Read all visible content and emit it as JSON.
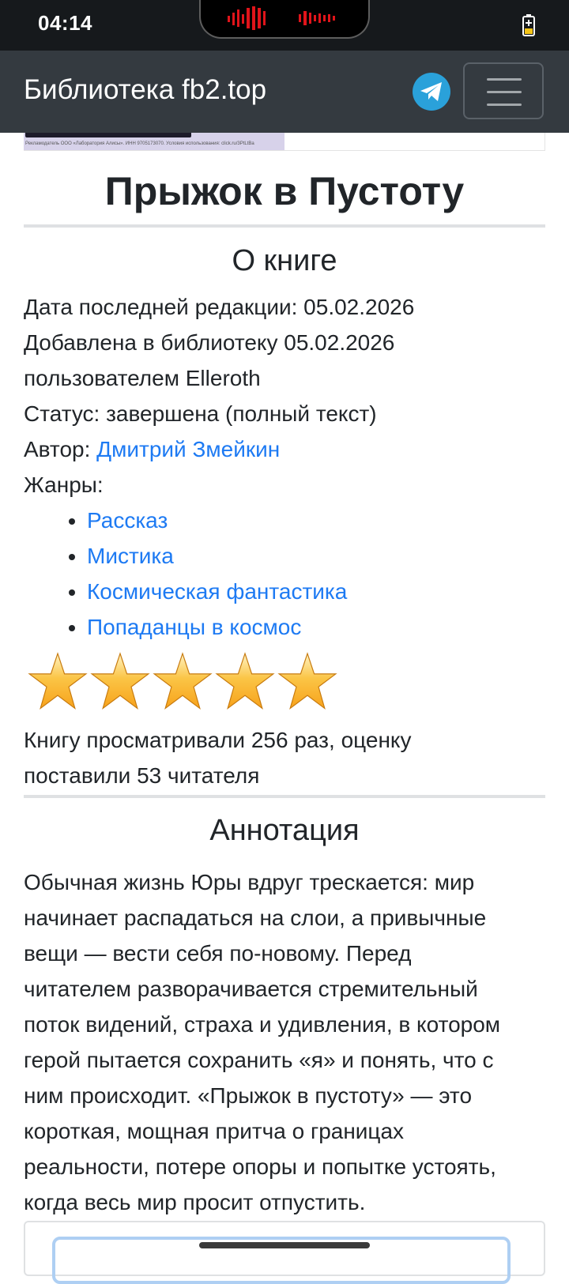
{
  "status_bar": {
    "time": "04:14"
  },
  "navbar": {
    "brand": "Библиотека fb2.top"
  },
  "book": {
    "title": "Прыжок в Пустоту",
    "about_heading": "О книге",
    "last_edit": "Дата последней редакции: 05.02.2026",
    "added_line1": "Добавлена в библиотеку 05.02.2026",
    "added_line2": "пользователем Elleroth",
    "status": "Статус: завершена (полный текст)",
    "author_label": "Автор: ",
    "author_name": "Дмитрий Змейкин",
    "genres_label": "Жанры:",
    "genres": [
      "Рассказ",
      "Мистика",
      "Космическая фантастика",
      "Попаданцы в космос"
    ],
    "rating": {
      "stars_filled": 5,
      "stars_total": 5
    },
    "views_line1": "Книгу просматривали 256 раз, оценку",
    "views_line2": "поставили 53 читателя"
  },
  "annotation": {
    "heading": "Аннотация",
    "lines": [
      "Обычная жизнь Юры вдруг трескается: мир",
      "начинает распадаться на слои, а привычные",
      "вещи — вести себя по-новому. Перед",
      "читателем разворачивается стремительный",
      "поток видений, страха и удивления, в котором",
      "герой пытается сохранить «я» и понять, что с",
      "ним происходит. «Прыжок в пустоту» — это",
      "короткая, мощная притча о границах",
      "реальности, потере опоры и попытке устоять,",
      "когда весь мир просит отпустить."
    ]
  },
  "ad_remnant": {
    "fine_print": "Рекламодатель ООО «Лаборатория Алисы». ИНН 9705173070. Условия использования: click.ru/3PtLtBa"
  },
  "colors": {
    "navbar": "#343a40",
    "link": "#1d7af3",
    "telegram": "#2aa1da",
    "star": "#f7a21b"
  }
}
